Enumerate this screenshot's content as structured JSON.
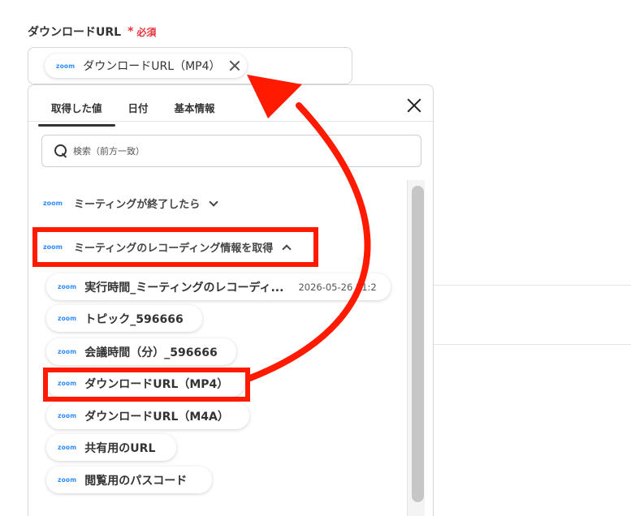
{
  "field": {
    "label": "ダウンロードURL",
    "required_mark": "*",
    "required_text": "必須",
    "selected_chip": {
      "logo": "zoom",
      "label": "ダウンロードURL（MP4）"
    }
  },
  "popup": {
    "tabs": [
      {
        "label": "取得した値",
        "active": true
      },
      {
        "label": "日付",
        "active": false
      },
      {
        "label": "基本情報",
        "active": false
      }
    ],
    "search_placeholder": "検索（前方一致）",
    "sections": [
      {
        "logo": "zoom",
        "label": "ミーティングが終了したら",
        "expanded": false
      },
      {
        "logo": "zoom",
        "label": "ミーティングのレコーディング情報を取得",
        "expanded": true
      }
    ],
    "items": [
      {
        "logo": "zoom",
        "label": "実行時間_ミーティングのレコーディ...",
        "value": "2026-05-26 11:2"
      },
      {
        "logo": "zoom",
        "label": "トピック_596666"
      },
      {
        "logo": "zoom",
        "label": "会議時間（分）_596666"
      },
      {
        "logo": "zoom",
        "label": "ダウンロードURL（MP4）"
      },
      {
        "logo": "zoom",
        "label": "ダウンロードURL（M4A）"
      },
      {
        "logo": "zoom",
        "label": "共有用のURL"
      },
      {
        "logo": "zoom",
        "label": "閲覧用のパスコード"
      }
    ]
  },
  "colors": {
    "highlight": "#ff1a00",
    "zoom_blue": "#2d8cff",
    "required_red": "#e8343c"
  }
}
